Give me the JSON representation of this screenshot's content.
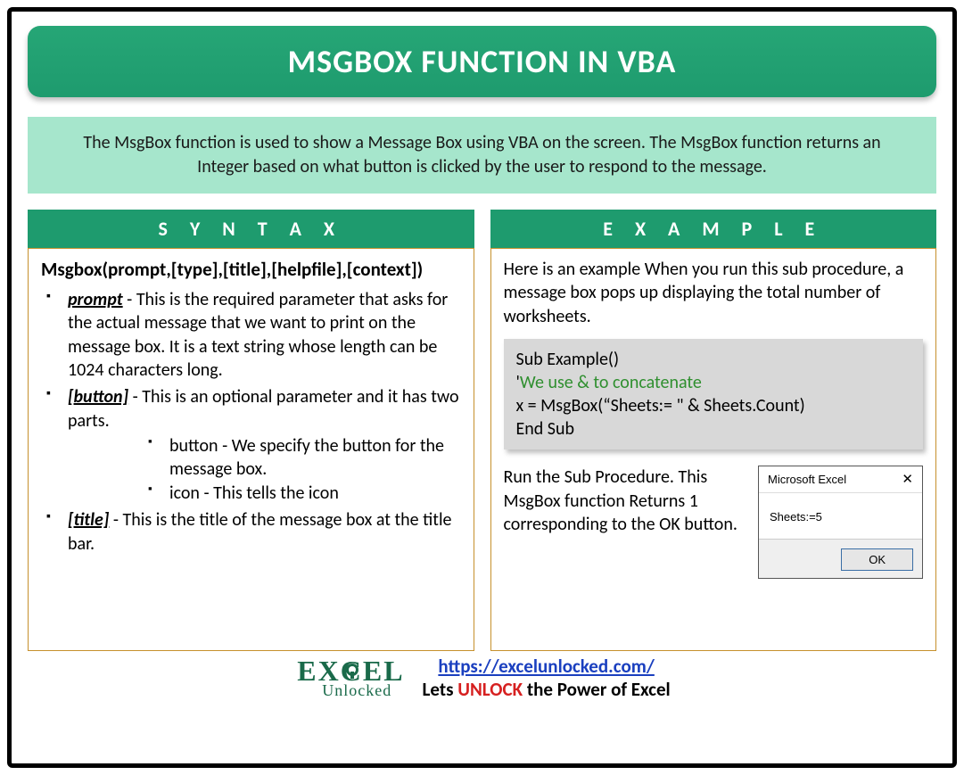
{
  "title": "MSGBOX FUNCTION IN VBA",
  "intro": "The MsgBox function is used to show a Message Box using VBA on the screen. The MsgBox function returns an Integer based on what button is clicked by the user to respond to the message.",
  "syntax": {
    "header": "S Y N T A X",
    "signature": "Msgbox(prompt,[type],[title],[helpfile],[context])",
    "params": [
      {
        "name": "prompt",
        "dash": " - ",
        "desc": "This is the required parameter that asks for the actual message that we want to print on the message box. It is a text string whose length can be 1024 characters long."
      },
      {
        "name": "[button]",
        "dash": " - ",
        "desc": "This is an optional parameter and it has two parts.",
        "sub": [
          "button - We specify the button for the message box.",
          "icon - This tells the icon"
        ]
      },
      {
        "name": "[title]",
        "dash": " - ",
        "desc": "This is the title of the message box at the title bar."
      }
    ]
  },
  "example": {
    "header": "E X A M P L E",
    "intro": "Here is an example When you run this sub procedure, a message box pops up displaying the total number of worksheets.",
    "code": {
      "l1": "Sub Example()",
      "l2a": "'",
      "l2b": "We use & to concatenate",
      "l3": "x = MsgBox(“Sheets:= \" & Sheets.Count)",
      "l4": "End Sub"
    },
    "run_text": "Run the Sub Procedure. This MsgBox function Returns 1 corresponding to the OK button.",
    "msgbox": {
      "title": "Microsoft Excel",
      "body": "Sheets:=5",
      "ok": "OK"
    }
  },
  "footer": {
    "logo_l1": "EXCEL",
    "logo_l2": "Unlocked",
    "url": "https://excelunlocked.com/",
    "tag_a": "Lets ",
    "tag_b": "UNLOCK",
    "tag_c": " the Power of Excel"
  }
}
